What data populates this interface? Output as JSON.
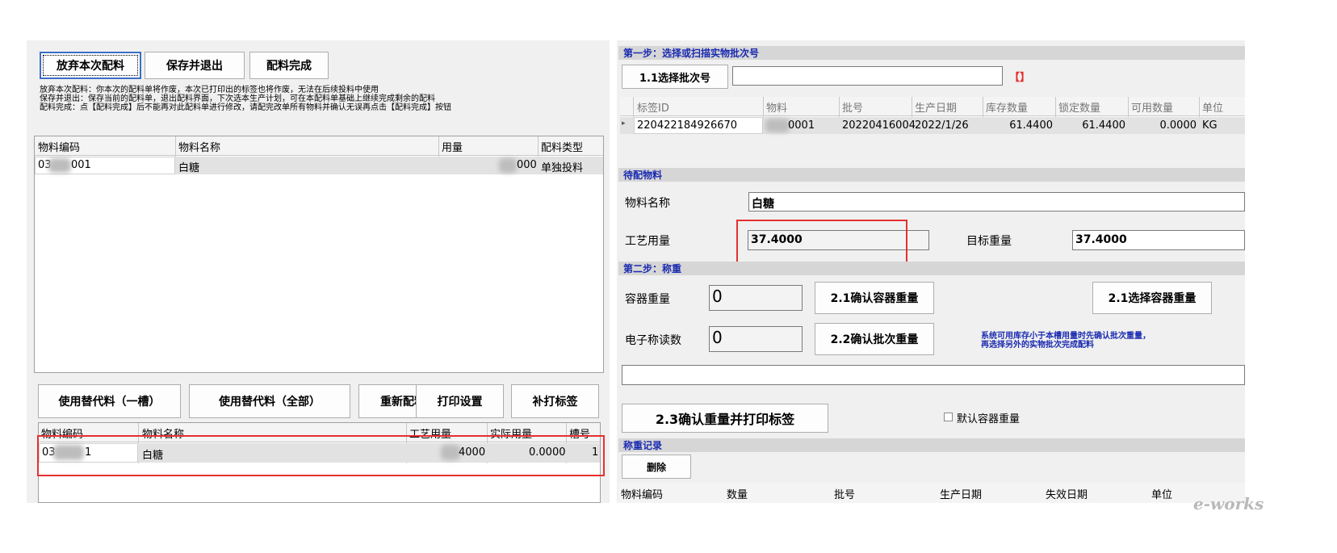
{
  "left": {
    "toolbar": {
      "abandon": "放弃本次配料",
      "save_exit": "保存并退出",
      "complete": "配料完成"
    },
    "notes": [
      "放弃本次配料：你本次的配料单将作废，本次已打印出的标签也将作废，无法在后续投料中使用",
      "保存并退出：保存当前的配料单，退出配料界面，下次选本生产计划，可在本配料单基础上继续完成剩余的配料",
      "配料完成：点【配料完成】后不能再对此配料单进行修改，请配完改单所有物料并确认无误再点击【配料完成】按钮"
    ],
    "grid1": {
      "columns": [
        "物料编码",
        "物料名称",
        "用量",
        "配料类型"
      ],
      "rows": [
        {
          "code": "03",
          "code_tail": "001",
          "name": "白糖",
          "qty": "000",
          "type": "单独投料"
        }
      ]
    },
    "buttons": {
      "sub_one": "使用替代料（一槽）",
      "sub_all": "使用替代料（全部）",
      "redo": "重新配料",
      "print_settings": "打印设置",
      "reprint": "补打标签"
    },
    "grid2": {
      "columns": [
        "物料编码",
        "物料名称",
        "工艺用量",
        "实际用量",
        "槽号"
      ],
      "rows": [
        {
          "code": "03",
          "code_tail": "1",
          "name": "白糖",
          "process_qty": "4000",
          "actual_qty": "0.0000",
          "slot": "1"
        }
      ]
    }
  },
  "right": {
    "step1": {
      "title": "第一步：选择或扫描实物批次号",
      "select_button": "1.1选择批次号",
      "batch_value": "",
      "bracket": "【】"
    },
    "batch_grid": {
      "columns": [
        "标签ID",
        "物料",
        "批号",
        "生产日期",
        "库存数量",
        "锁定数量",
        "可用数量",
        "单位"
      ],
      "rows": [
        {
          "label_id": "220422184926670",
          "material": "0001",
          "batch": "20220416004",
          "date": "2022/1/26",
          "stock": "61.4400",
          "locked": "61.4400",
          "available": "0.0000",
          "unit": "KG"
        }
      ]
    },
    "pending": {
      "title": "待配物料",
      "name_label": "物料名称",
      "name_value": "白糖",
      "process_label": "工艺用量",
      "process_value": "37.4000",
      "target_label": "目标重量",
      "target_value": "37.4000"
    },
    "step2": {
      "title": "第二步：称重",
      "container_label": "容器重量",
      "container_value": "0",
      "confirm_container": "2.1确认容器重量",
      "select_container": "2.1选择容器重量",
      "scale_label": "电子称读数",
      "scale_value": "0",
      "confirm_batch": "2.2确认批次重量",
      "hint_line1": "系统可用库存小于本槽用量时先确认批次重量，",
      "hint_line2": "再选择另外的实物批次完成配料",
      "confirm_print": "2.3确认重量并打印标签",
      "default_container": "默认容器重量"
    },
    "records": {
      "title": "称重记录",
      "delete": "删除",
      "columns": [
        "物料编码",
        "数量",
        "批号",
        "生产日期",
        "失效日期",
        "单位"
      ]
    }
  },
  "watermark": "e-works",
  "colors": {
    "section_title": "#1a2ab0",
    "highlight_box": "#e53030",
    "bracket": "#e53030",
    "hint_text": "#1a2ab0"
  }
}
